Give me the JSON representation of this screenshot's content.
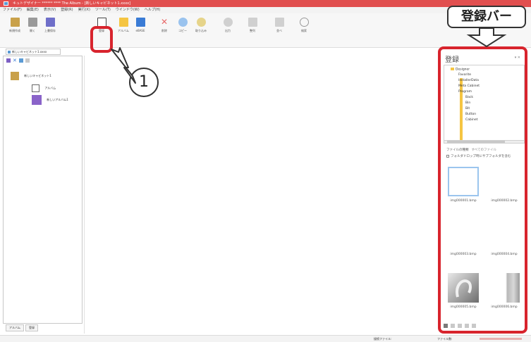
{
  "window": {
    "title": "キュトデザイナー ****** **** The Album - [新しいキャビネット1.xxxx]"
  },
  "menubar": [
    "ファイル(F)",
    "編集(E)",
    "表示(V)",
    "登録(R)",
    "実行(X)",
    "ツール(T)",
    "ウインドウ(W)",
    "ヘルプ(H)"
  ],
  "toolbar": {
    "buttons": [
      {
        "label": "新規作成",
        "icon": "new-cabinet-icon",
        "color": "#c9a14a"
      },
      {
        "label": "開く",
        "icon": "open-icon",
        "color": "#9a9a9a"
      },
      {
        "label": "上書保存",
        "icon": "save-icon",
        "color": "#6f6fc9"
      },
      {
        "label": "登録",
        "icon": "register-icon",
        "color": "#d9d9d9"
      },
      {
        "label": "アルバム",
        "icon": "album-icon",
        "color": "#f5c542"
      },
      {
        "label": "eBASE",
        "icon": "ebase-icon",
        "color": "#3a7bd5"
      },
      {
        "label": "削除",
        "icon": "delete-icon",
        "color": "#e86a6a"
      },
      {
        "label": "コピー",
        "icon": "copy-icon",
        "color": "#9ac3ee"
      },
      {
        "label": "取り込み",
        "icon": "import-icon",
        "color": "#e6d48a"
      },
      {
        "label": "出力",
        "icon": "export-icon",
        "color": "#d0d0d0"
      },
      {
        "label": "整列",
        "icon": "sort-icon",
        "color": "#d0d0d0"
      },
      {
        "label": "並べ",
        "icon": "arrange-icon",
        "color": "#d0d0d0"
      },
      {
        "label": "検索",
        "icon": "search-icon",
        "color": "#d0d0d0"
      }
    ]
  },
  "doc_tab": {
    "label": "新しいキャビネット1.xxxx"
  },
  "left_tree": {
    "root": "新しいキャビネット1",
    "items": [
      "アルバム",
      "新しいアルバム1"
    ]
  },
  "bottom_tabs": [
    "アルバム",
    "登録"
  ],
  "registration_panel": {
    "title": "登録",
    "folders": [
      "Designer",
      "Favorite",
      "InstallerData",
      "Meta Cabinet",
      "Program",
      "Back",
      "Bin",
      "Bit",
      "Button",
      "Cabinet"
    ],
    "file_kind_label": "ファイルの種類",
    "file_kind_value": "すべてのファイル",
    "subfolder_label": "フォルダドロップ時にサブフォルダを含む",
    "thumbnails": [
      "img000001.bmp",
      "img000002.bmp",
      "img000003.bmp",
      "img000004.bmp",
      "img000005.bmp",
      "img000006.bmp"
    ]
  },
  "status": {
    "mid": "接続ファイル:",
    "right": "ファイル数:"
  },
  "annotations": {
    "callout": "登録バー",
    "step_number": "1"
  },
  "colors": {
    "accent_red": "#d8242d",
    "title_bar": "#e14f4f",
    "folder": "#f5c542"
  }
}
